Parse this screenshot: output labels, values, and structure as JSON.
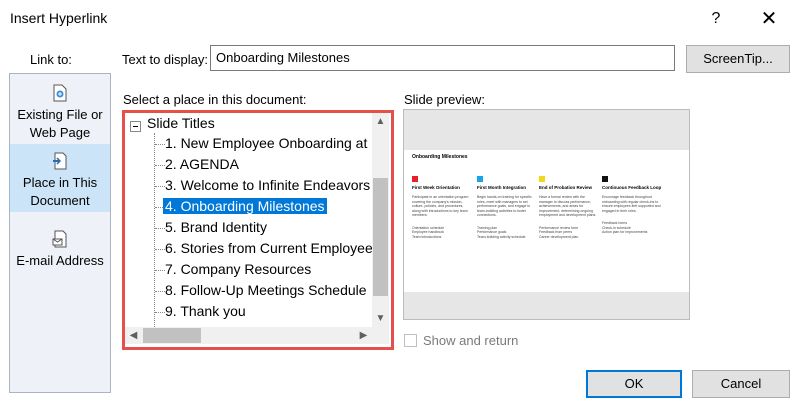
{
  "window": {
    "title": "Insert Hyperlink",
    "help_label": "?",
    "close_label": "✕"
  },
  "link_to": {
    "label": "Link to:",
    "items": [
      {
        "label": "Existing File or Web Page",
        "icon": "file-icon"
      },
      {
        "label": "Place in This Document",
        "icon": "document-icon",
        "selected": true
      },
      {
        "label": "E-mail Address",
        "icon": "email-icon"
      }
    ]
  },
  "text_to_display": {
    "label": "Text to display:",
    "value": "Onboarding Milestones"
  },
  "screentip_label": "ScreenTip...",
  "select_place": {
    "label": "Select a place in this document:",
    "root": "Slide Titles",
    "items": [
      "1. New Employee Onboarding at",
      "2. AGENDA",
      "3. Welcome to Infinite Endeavors",
      "4. Onboarding Milestones",
      "5. Brand Identity",
      "6. Stories from Current Employee",
      "7. Company Resources",
      "8. Follow-Up Meetings Schedule",
      "9. Thank you"
    ],
    "selected_index": 3
  },
  "slide_preview": {
    "label": "Slide preview:",
    "slide_title": "Onboarding Milestones",
    "columns": [
      {
        "heading": "First Week Orientation",
        "color": "#e8202a",
        "body": "Participate in an orientation program covering the company's mission, culture, policies, and procedures, along with introductions to key team members.",
        "list": "Orientation schedule\nEmployee handbook\nTeam introductions"
      },
      {
        "heading": "First Month Integration",
        "color": "#1aa3e8",
        "body": "Begin hands-on training for specific roles, meet with managers to set performance goals, and engage in team-building activities to foster connections.",
        "list": "Training plan\nPerformance goals\nTeam-building activity schedule"
      },
      {
        "heading": "End of Probation Review",
        "color": "#f2d81c",
        "body": "Have a formal review with the manager to discuss performance, achievements, and areas for improvement, determining ongoing employment and development plans.",
        "list": "Performance review form\nFeedback from peers\nCareer development plan"
      },
      {
        "heading": "Continuous Feedback Loop",
        "color": "#111111",
        "body": "Encourage feedback throughout onboarding with regular check-ins to ensure employees feel supported and engaged in their roles.",
        "list": "Feedback forms\nCheck-in schedule\nAction plan for improvements"
      }
    ]
  },
  "show_and_return": "Show and return",
  "buttons": {
    "ok": "OK",
    "cancel": "Cancel"
  },
  "colors": {
    "accent": "#0078d7",
    "highlight_border": "#e6504a",
    "selected_nav": "#cce4f7"
  }
}
